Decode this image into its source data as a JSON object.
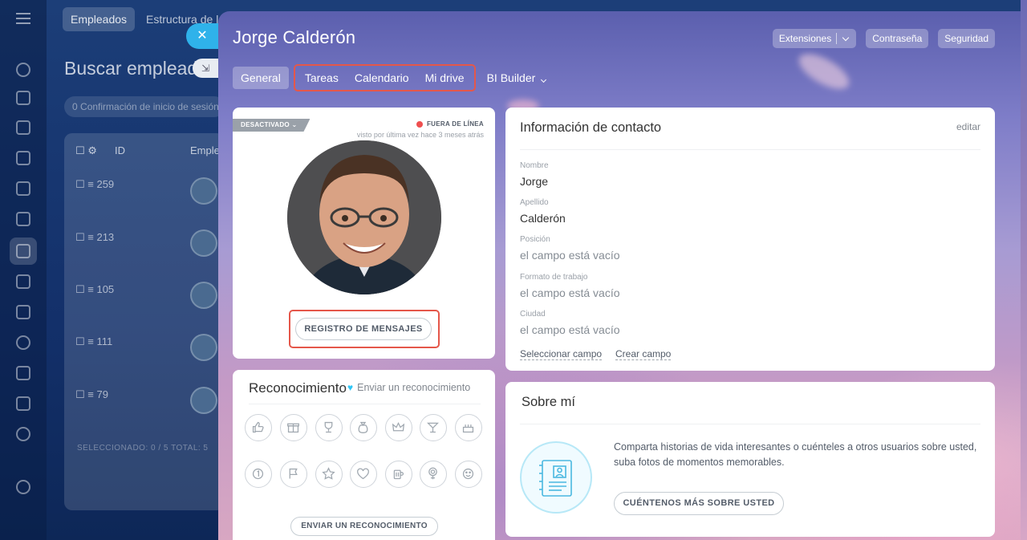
{
  "background": {
    "tabs": [
      "Empleados",
      "Estructura de la"
    ],
    "title": "Buscar emplead",
    "chip": "Confirmación de inicio de sesión",
    "chip_count": "0",
    "table_headers": [
      "ID",
      "Emple"
    ],
    "rows": [
      "259",
      "213",
      "105",
      "111",
      "79"
    ],
    "footer": "SELECCIONADO: 0 / 5    TOTAL: 5",
    "close_icon": "close-icon",
    "pin_icon": "collapse-icon"
  },
  "panel": {
    "title": "Jorge Calderón",
    "header_buttons": {
      "extensions": "Extensiones",
      "password": "Contraseña",
      "security": "Seguridad"
    },
    "tabs": {
      "general": "General",
      "tasks": "Tareas",
      "calendar": "Calendario",
      "drive": "Mi drive",
      "bi": "BI Builder"
    }
  },
  "profile": {
    "status": "DESACTIVADO",
    "online_status": "FUERA DE LÍNEA",
    "last_seen": "visto por última vez hace 3 meses atrás",
    "message_log_button": "REGISTRO DE MENSAJES"
  },
  "recognition": {
    "title": "Reconocimiento",
    "send_link": "Enviar un reconocimiento",
    "send_button": "ENVIAR UN RECONOCIMIENTO",
    "badges": [
      "thumbs-up-icon",
      "gift-icon",
      "trophy-icon",
      "money-bag-icon",
      "crown-icon",
      "cocktail-icon",
      "cake-icon",
      "number-one-icon",
      "flag-icon",
      "star-icon",
      "heart-icon",
      "beer-icon",
      "flower-icon",
      "smile-icon"
    ]
  },
  "contact": {
    "title": "Información de contacto",
    "edit": "editar",
    "fields": [
      {
        "label": "Nombre",
        "value": "Jorge"
      },
      {
        "label": "Apellido",
        "value": "Calderón"
      },
      {
        "label": "Posición",
        "value": "el campo está vacío"
      },
      {
        "label": "Formato de trabajo",
        "value": "el campo está vacío"
      },
      {
        "label": "Ciudad",
        "value": "el campo está vacío"
      }
    ],
    "select_field": "Seleccionar campo",
    "create_field": "Crear campo"
  },
  "about": {
    "title": "Sobre mí",
    "text": "Comparta historias de vida interesantes o cuénteles a otros usuarios sobre usted, suba fotos de momentos memorables.",
    "button": "CUÉNTENOS MÁS SOBRE USTED"
  },
  "colors": {
    "accent": "#2fb2ea",
    "highlight": "#e5574a",
    "offline": "#ef4f4f"
  }
}
